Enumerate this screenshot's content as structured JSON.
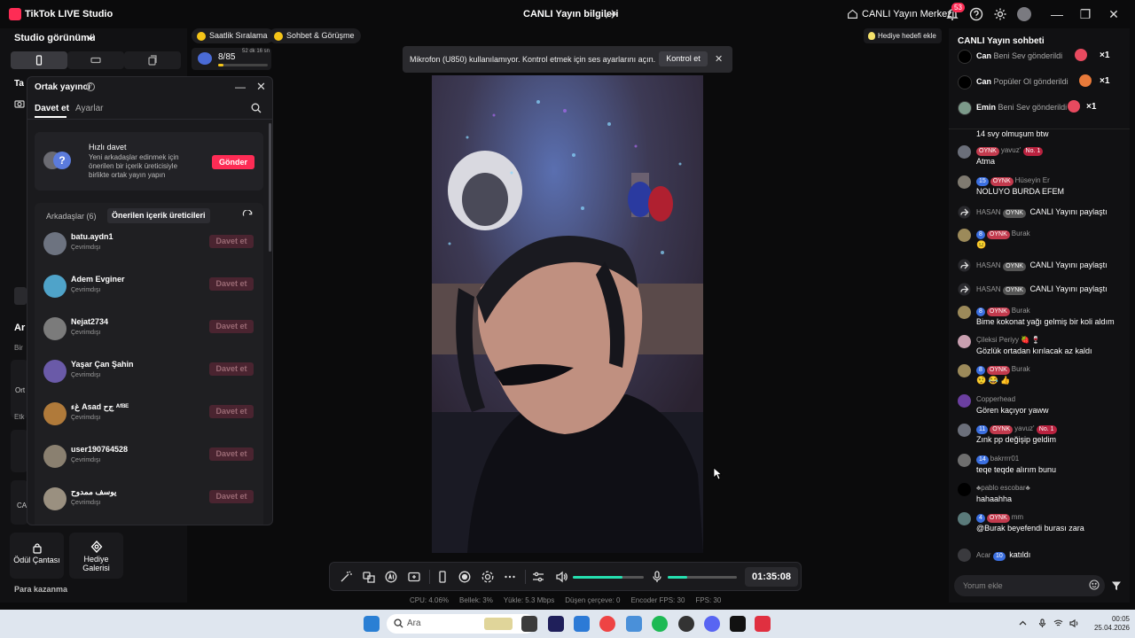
{
  "titlebar": {
    "app_name": "TikTok LIVE Studio",
    "window_title": "CANLI Yayın bilgileri",
    "live_center": "CANLI Yayın Merkezi",
    "notification_count": "53"
  },
  "left_panel": {
    "studio_view": "Studio görünümü",
    "fragments": {
      "ta": "Ta",
      "ar": "Ar",
      "bir": "Bir",
      "ort": "Ort",
      "etk": "Etk",
      "ca": "CA"
    },
    "reward_bag": "Ödül Çantası",
    "gift_gallery": "Hediye Galerisi",
    "earn_money": "Para kazanma"
  },
  "chips": {
    "hourly_ranking": "Saatlik Sıralama",
    "chat_meeting": "Sohbet & Görüşme",
    "level": "8/85",
    "level_time": "52 dk 16 sn",
    "level_progress": 0.1
  },
  "co_host": {
    "title": "Ortak yayıncı",
    "tab_invite": "Davet et",
    "tab_settings": "Ayarlar",
    "quick_title": "Hızlı davet",
    "quick_desc": "Yeni arkadaşlar edinmek için önerilen bir içerik üreticisiyle birlikte ortak yayın yapın",
    "send": "Gönder",
    "friends_tab": "Arkadaşlar (6)",
    "suggested_tab": "Önerilen içerik üreticileri",
    "rows": [
      {
        "name": "batu.aydn1",
        "status": "Çevrimdışı",
        "button": "Davet et",
        "color": "#6d7380"
      },
      {
        "name": "Adem Evginer",
        "status": "Çevrimdışı",
        "button": "Davet et",
        "color": "#4fa3c9"
      },
      {
        "name": "Nejat2734",
        "status": "Çevrimdışı",
        "button": "Davet et",
        "color": "#7b7b7b"
      },
      {
        "name": "Yaşar Çan Şahin",
        "status": "Çevrimdışı",
        "button": "Davet et",
        "color": "#6a5aa8"
      },
      {
        "name": "ﻍء Asad ﺝﺡ ᴬᶠᴮᴱ",
        "status": "Çevrimdışı",
        "button": "Davet et",
        "color": "#b07a3a"
      },
      {
        "name": "user190764528",
        "status": "Çevrimdışı",
        "button": "Davet et",
        "color": "#8a8070"
      },
      {
        "name": "يوسف ممدوح",
        "status": "Çevrimdışı",
        "button": "Davet et",
        "color": "#9a9080"
      }
    ]
  },
  "mic_toast": {
    "text": "Mikrofon (U850) kullanılamıyor. Kontrol etmek için ses ayarlarını açın.",
    "button": "Kontrol et"
  },
  "gift_goal": "Hediye hedefi ekle",
  "controls": {
    "timer": "01:35:08",
    "volume": 0.7,
    "mic_level": 0.28
  },
  "stats": {
    "cpu": "CPU: 4.06%",
    "memory": "Bellek: 3%",
    "upload": "Yükle: 5.3 Mbps",
    "dropped": "Düşen çerçeve: 0",
    "encoder_fps": "Encoder FPS: 30",
    "fps": "FPS: 30"
  },
  "chat": {
    "title": "CANLI Yayın sohbeti",
    "gifts": [
      {
        "user": "Can",
        "text": "Beni Sev gönderildi",
        "count": "×1",
        "avatar": "#000000",
        "gift_color": "#e84a5f"
      },
      {
        "user": "Can",
        "text": "Popüler Ol gönderildi",
        "count": "×1",
        "avatar": "#000000",
        "gift_color": "#e87a3a"
      },
      {
        "user": "Emin",
        "text": "Beni Sev gönderildi",
        "count": "×1",
        "avatar": "#7c9a8a",
        "gift_color": "#e84a5f"
      }
    ],
    "messages": [
      {
        "header": "",
        "body": "14 svy olmuşum btw",
        "avatar": ""
      },
      {
        "badges": [
          [
            "OYNK",
            "b-red"
          ]
        ],
        "name": "yavuz'",
        "extra_badge": [
          "No. 1",
          "b-no1"
        ],
        "body": "Atma",
        "avatar": "#6b6f7a"
      },
      {
        "badges": [
          [
            "15",
            "b-blue"
          ],
          [
            "OYNK",
            "b-red"
          ]
        ],
        "name": "Hüseyin Er",
        "body": "NOLUYO BURDA EFEM",
        "avatar": "#7f7a70"
      },
      {
        "inline_name": "HASAN",
        "badges": [
          [
            "OYNK",
            "b-grey"
          ]
        ],
        "inline": "CANLI Yayını paylaştı",
        "avatar": "#2a2a2e",
        "share": true
      },
      {
        "badges": [
          [
            "8",
            "b-blue"
          ],
          [
            "OYNK",
            "b-red"
          ]
        ],
        "name": "Burak",
        "body": "😐",
        "avatar": "#9c8a5a"
      },
      {
        "inline_name": "HASAN",
        "badges": [
          [
            "OYNK",
            "b-grey"
          ]
        ],
        "inline": "CANLI Yayını paylaştı",
        "avatar": "#2a2a2e",
        "share": true
      },
      {
        "inline_name": "HASAN",
        "badges": [
          [
            "OYNK",
            "b-grey"
          ]
        ],
        "inline": "CANLI Yayını paylaştı",
        "avatar": "#2a2a2e",
        "share": true
      },
      {
        "badges": [
          [
            "8",
            "b-blue"
          ],
          [
            "OYNK",
            "b-red"
          ]
        ],
        "name": "Burak",
        "body": "Bime kokonat yağı gelmiş bir koli aldım",
        "avatar": "#9c8a5a"
      },
      {
        "name": "Çileksi Periyy 🍓 🍷",
        "body": "Gözlük ortadan kırılacak az kaldı",
        "avatar": "#c9a0b0"
      },
      {
        "badges": [
          [
            "8",
            "b-blue"
          ],
          [
            "OYNK",
            "b-red"
          ]
        ],
        "name": "Burak",
        "body": "🤨 😂 👍",
        "avatar": "#9c8a5a"
      },
      {
        "name": "Copperhead",
        "body": "Gören kaçıyor yaww",
        "avatar": "#6b3fa0"
      },
      {
        "badges": [
          [
            "11",
            "b-blue"
          ],
          [
            "OYNK",
            "b-red"
          ]
        ],
        "name": "yavuz'",
        "extra_badge": [
          "No. 1",
          "b-no1"
        ],
        "body": "Zınk pp değişip geldim",
        "avatar": "#6b6f7a"
      },
      {
        "badges": [
          [
            "14",
            "b-blue"
          ]
        ],
        "name": "bakrrrr01",
        "body": "teqe teqde alırım bunu",
        "avatar": "#6e6e6e"
      },
      {
        "name": "♣pablo escobar♣",
        "body": "hahaahha",
        "avatar": "#000000"
      },
      {
        "badges": [
          [
            "4",
            "b-blue"
          ],
          [
            "OYNK",
            "b-red"
          ]
        ],
        "name": "mm",
        "body": "@Burak beyefendi burası zara",
        "avatar": "#5a7a7a"
      },
      {
        "inline_name": "Acar",
        "badges": [
          [
            "10",
            "b-blue"
          ]
        ],
        "inline": "katıldı",
        "avatar": "#3a3a3e",
        "join": true
      }
    ],
    "input_placeholder": "Yorum ekle"
  },
  "taskbar": {
    "search": "Ara",
    "time": "00:05",
    "date": "25.04.2026"
  }
}
